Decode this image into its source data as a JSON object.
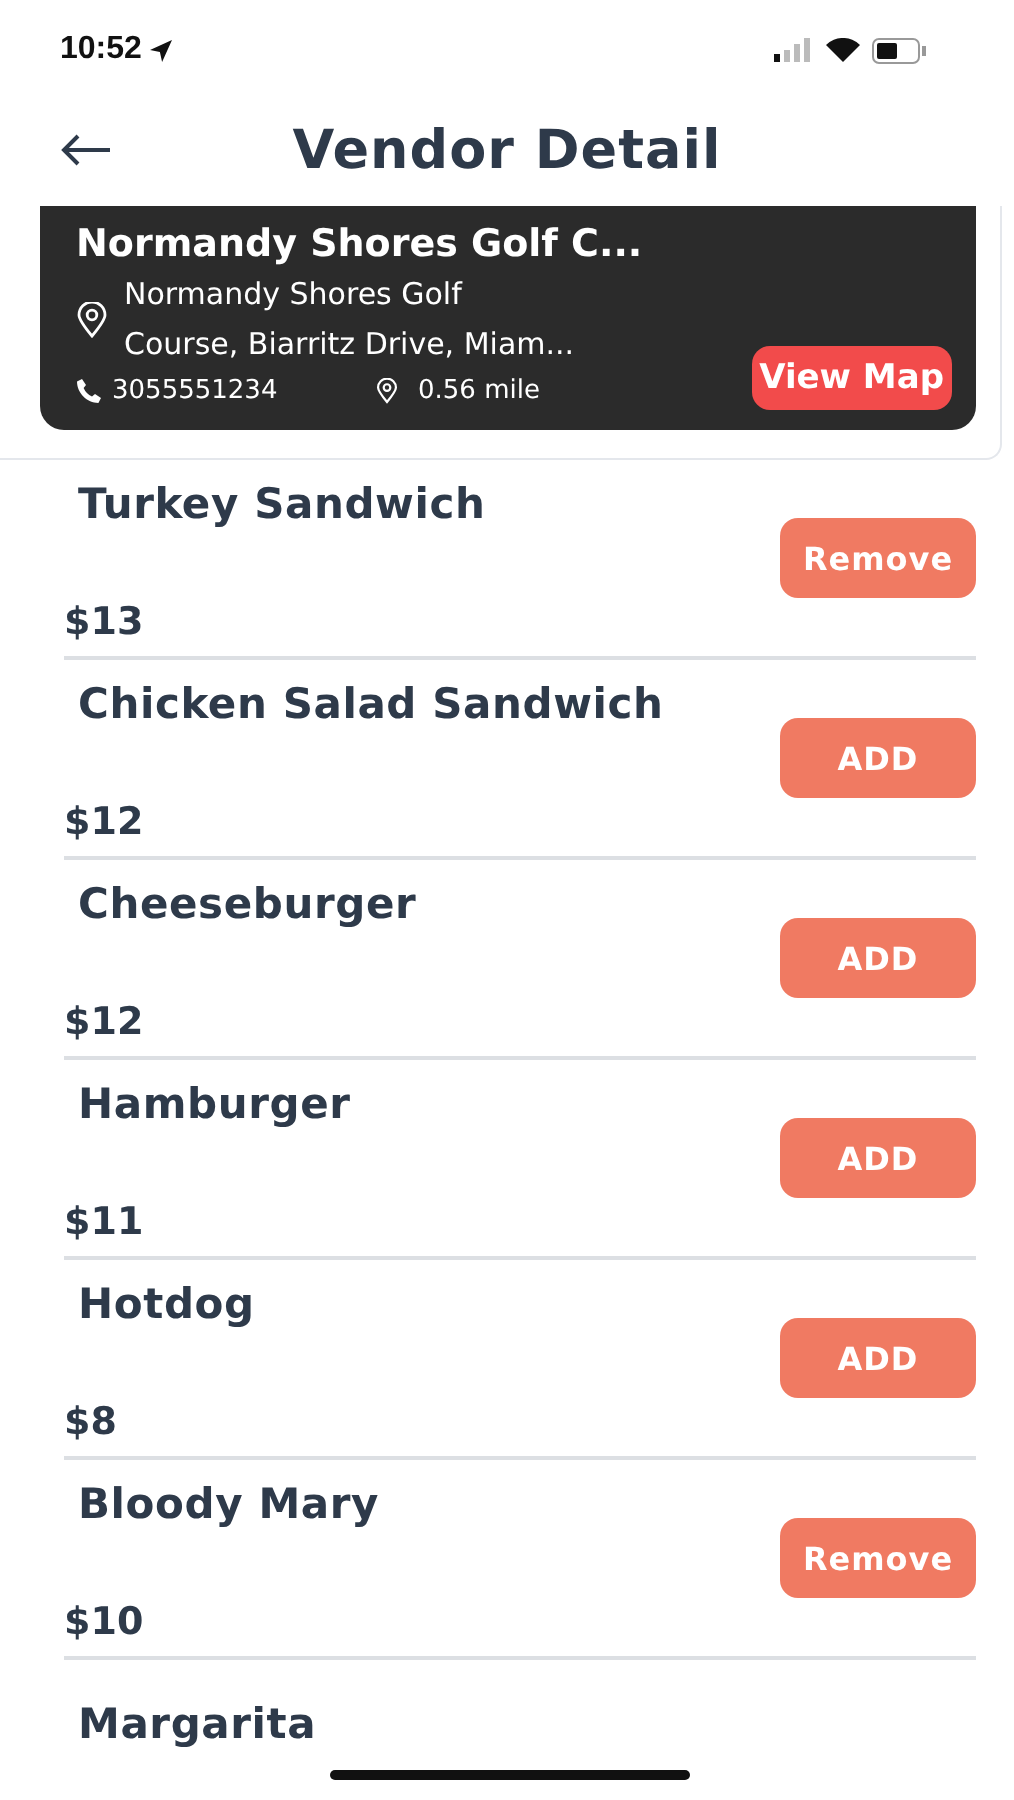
{
  "status_bar": {
    "time": "10:52"
  },
  "header": {
    "title": "Vendor Detail"
  },
  "vendor": {
    "name": "Normandy Shores Golf C...",
    "address_lines": [
      "Normandy Shores Golf",
      "Course, Biarritz Drive, Miam..."
    ],
    "phone": "3055551234",
    "distance": "0.56 mile",
    "map_button": "View Map"
  },
  "items": [
    {
      "name": "Turkey Sandwich",
      "price": "$13",
      "button": "Remove"
    },
    {
      "name": "Chicken Salad Sandwich",
      "price": "$12",
      "button": "ADD"
    },
    {
      "name": "Cheeseburger",
      "price": "$12",
      "button": "ADD"
    },
    {
      "name": "Hamburger",
      "price": "$11",
      "button": "ADD"
    },
    {
      "name": "Hotdog",
      "price": "$8",
      "button": "ADD"
    },
    {
      "name": "Bloody Mary",
      "price": "$10",
      "button": "Remove"
    },
    {
      "name": "Margarita"
    }
  ]
}
